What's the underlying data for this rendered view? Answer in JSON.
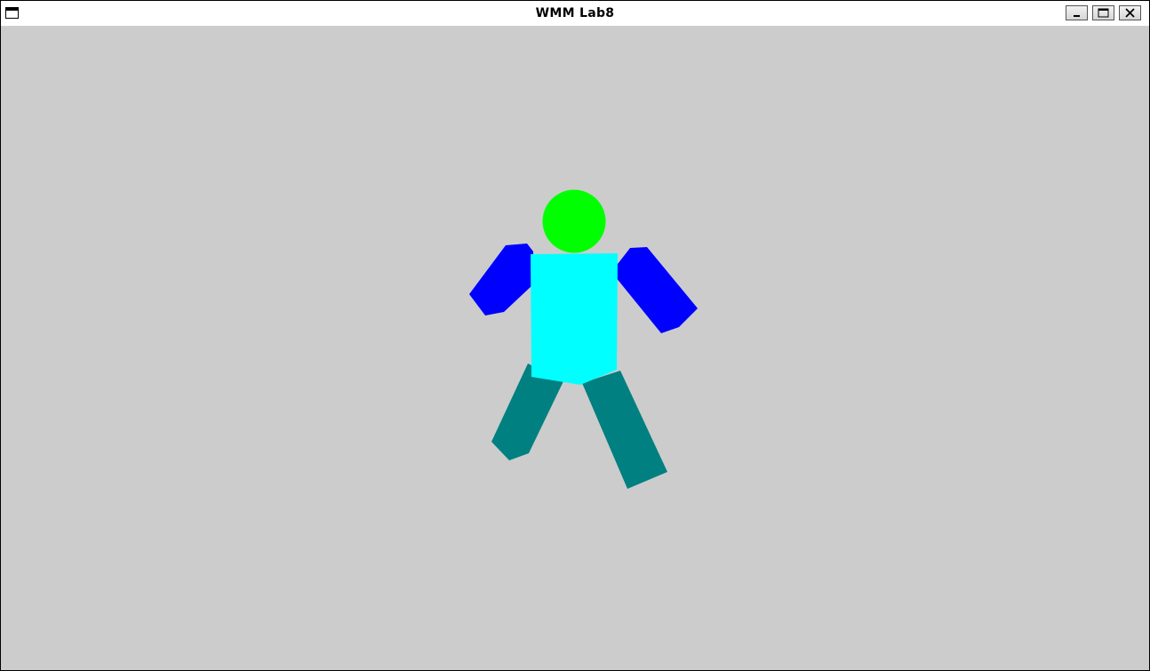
{
  "window": {
    "title": "WMM Lab8"
  },
  "scene": {
    "background_color": "#cccccc",
    "colors": {
      "head": "#00ff00",
      "torso": "#00ffff",
      "arms": "#0000ff",
      "legs": "#008080"
    }
  }
}
